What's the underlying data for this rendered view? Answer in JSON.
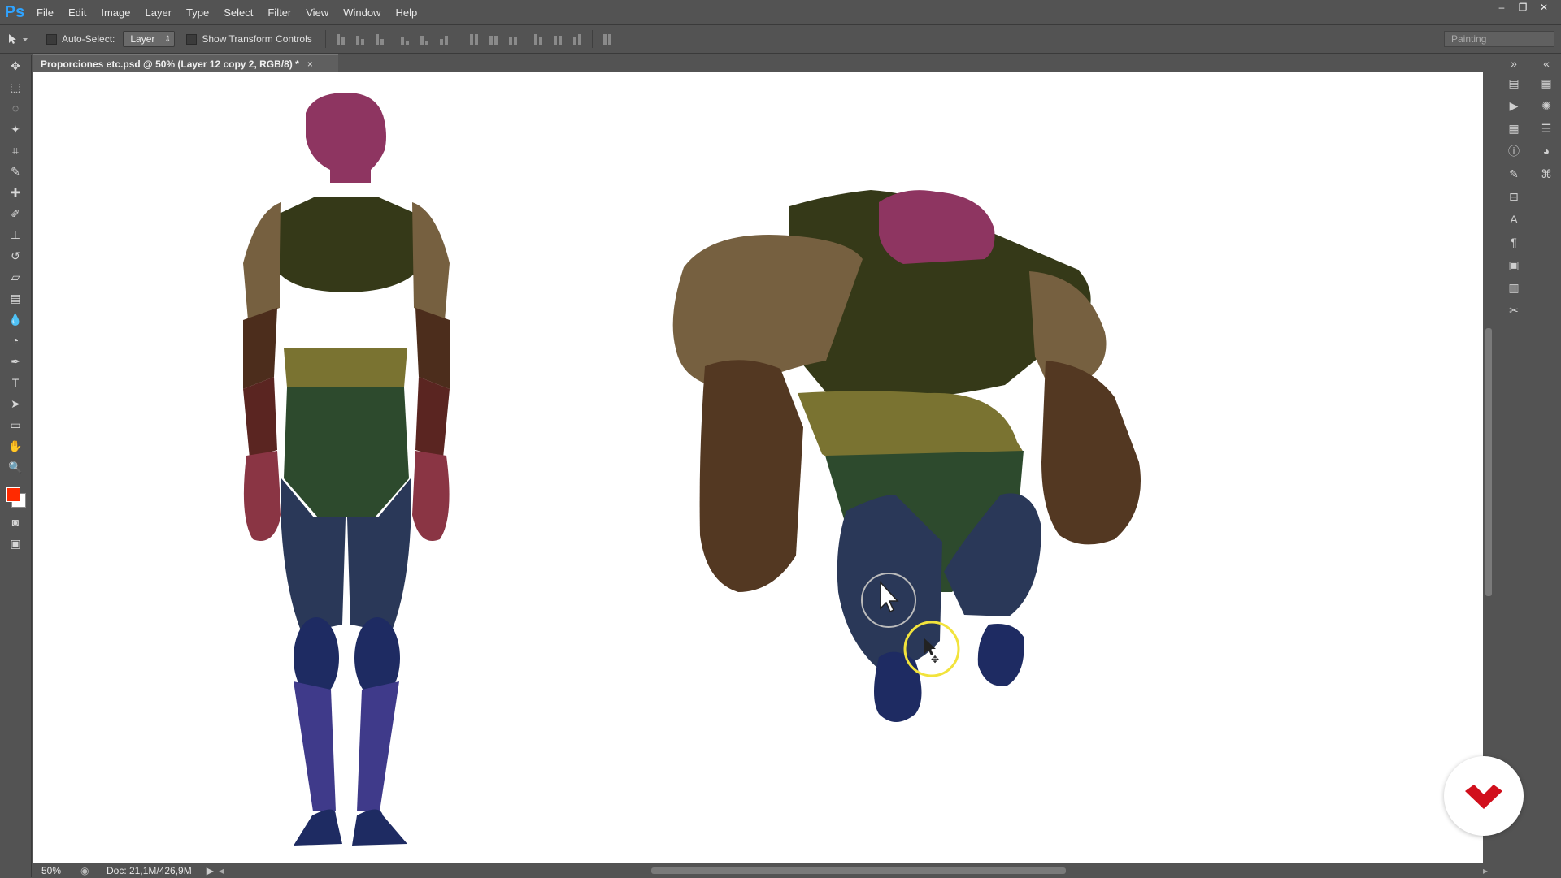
{
  "app": {
    "logo": "Ps"
  },
  "menu": [
    "File",
    "Edit",
    "Image",
    "Layer",
    "Type",
    "Select",
    "Filter",
    "View",
    "Window",
    "Help"
  ],
  "window_controls": {
    "minimize": "–",
    "maximize": "❐",
    "close": "✕"
  },
  "options": {
    "auto_select_label": "Auto-Select:",
    "auto_select_value": "Layer",
    "transform_label": "Show Transform Controls",
    "workspace": "Painting"
  },
  "document": {
    "tab_title": "Proporciones etc.psd @ 50% (Layer 12 copy 2, RGB/8) *",
    "close": "×"
  },
  "status": {
    "zoom": "50%",
    "doc_size": "Doc: 21,1M/426,9M"
  },
  "colors": {
    "foreground": "#ff2a00",
    "background": "#ffffff"
  },
  "tools": [
    "move-tool",
    "marquee-tool",
    "lasso-tool",
    "magic-wand-tool",
    "crop-tool",
    "eyedropper-tool",
    "healing-brush-tool",
    "brush-tool",
    "clone-stamp-tool",
    "history-brush-tool",
    "eraser-tool",
    "gradient-tool",
    "blur-tool",
    "dodge-tool",
    "pen-tool",
    "type-tool",
    "path-selection-tool",
    "rectangle-tool",
    "hand-tool",
    "zoom-tool"
  ]
}
